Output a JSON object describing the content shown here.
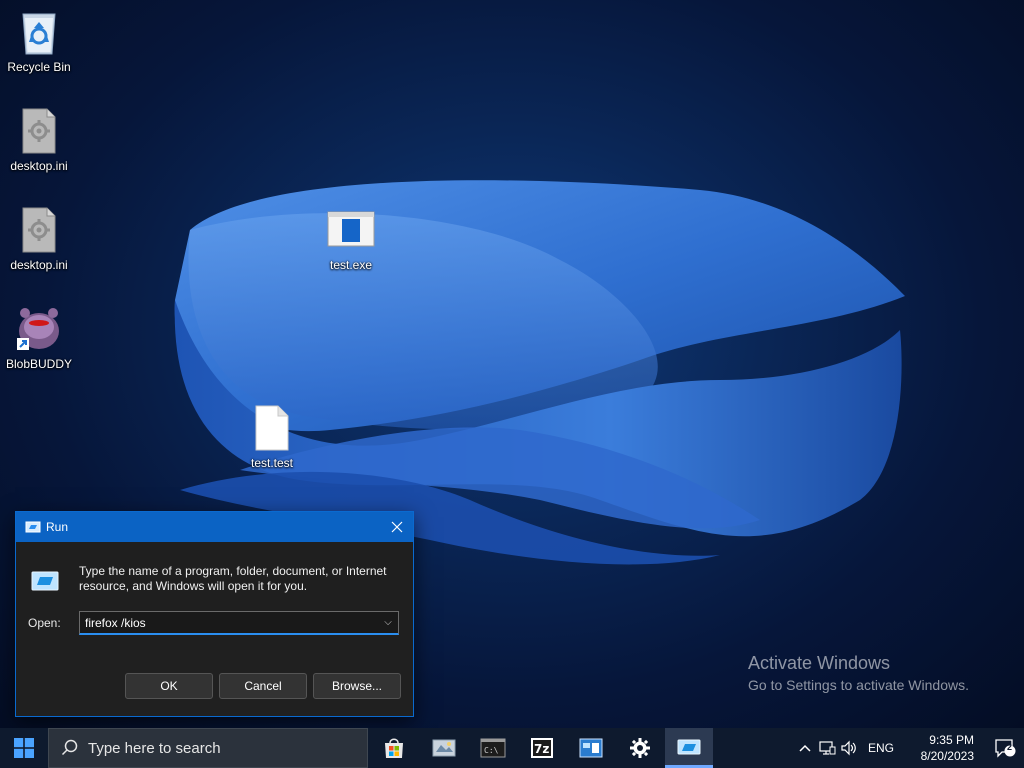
{
  "desktop": {
    "icons": [
      {
        "label": "Recycle Bin",
        "icon": "recycle-bin-icon"
      },
      {
        "label": "desktop.ini",
        "icon": "settings-file-icon"
      },
      {
        "label": "desktop.ini",
        "icon": "settings-file-icon"
      },
      {
        "label": "BlobBUDDY",
        "icon": "blobbuddy-shortcut-icon"
      },
      {
        "label": "test.exe",
        "icon": "executable-icon"
      },
      {
        "label": "test.test",
        "icon": "blank-file-icon"
      }
    ]
  },
  "watermark": {
    "title": "Activate Windows",
    "subtitle": "Go to Settings to activate Windows."
  },
  "run_dialog": {
    "title": "Run",
    "description": "Type the name of a program, folder, document, or Internet resource, and Windows will open it for you.",
    "open_label": "Open:",
    "input_value": "firefox /kios",
    "ok_label": "OK",
    "cancel_label": "Cancel",
    "browse_label": "Browse..."
  },
  "taskbar": {
    "search_placeholder": "Type here to search",
    "apps": [
      "store-icon",
      "file-explorer-icon",
      "command-prompt-icon",
      "7zip-icon",
      "control-panel-icon",
      "settings-icon",
      "run-icon"
    ],
    "lang": "ENG",
    "time": "9:35 PM",
    "date": "8/20/2023",
    "notification_count": "2"
  },
  "colors": {
    "titlebar": "#0b63c4",
    "taskbar": "#0e1a2e",
    "accent": "#2a8ef0"
  }
}
